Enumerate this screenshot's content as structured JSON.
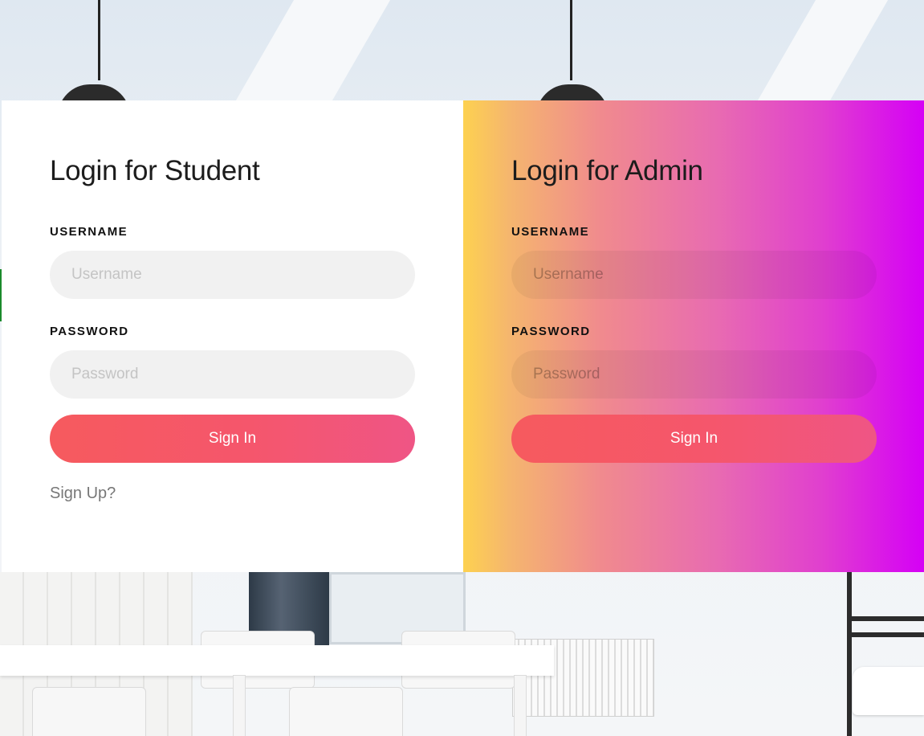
{
  "student": {
    "title": "Login for Student",
    "username_label": "USERNAME",
    "username_placeholder": "Username",
    "password_label": "PASSWORD",
    "password_placeholder": "Password",
    "signin_label": "Sign In",
    "signup_link": "Sign Up?"
  },
  "admin": {
    "title": "Login for Admin",
    "username_label": "USERNAME",
    "username_placeholder": "Username",
    "password_label": "PASSWORD",
    "password_placeholder": "Password",
    "signin_label": "Sign In"
  },
  "colors": {
    "button_accent": "#f5566c",
    "admin_gradient_start": "#fdd150",
    "admin_gradient_end": "#d500f6"
  }
}
